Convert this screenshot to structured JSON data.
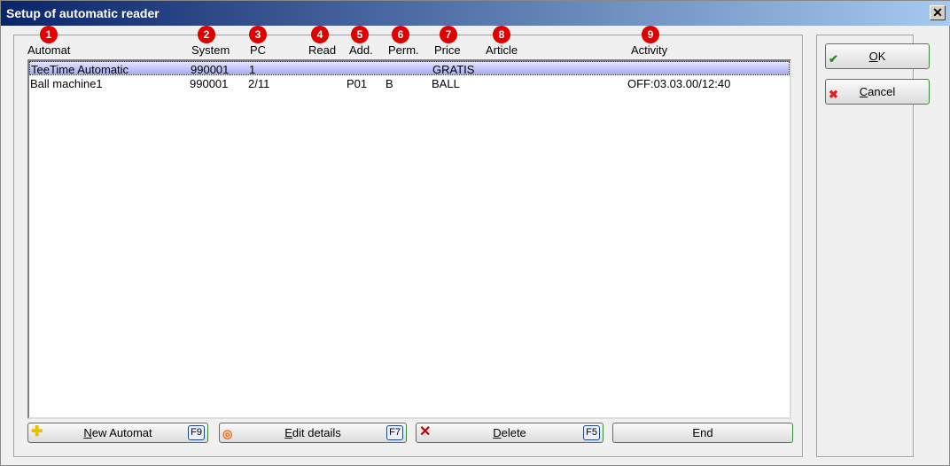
{
  "window": {
    "title": "Setup of automatic reader",
    "close": "✕"
  },
  "columns": [
    {
      "label": "Automat",
      "badge": "1"
    },
    {
      "label": "System",
      "badge": "2"
    },
    {
      "label": "PC",
      "badge": "3"
    },
    {
      "label": "Read",
      "badge": "4"
    },
    {
      "label": "Add.",
      "badge": "5"
    },
    {
      "label": "Perm.",
      "badge": "6"
    },
    {
      "label": "Price",
      "badge": "7"
    },
    {
      "label": "Article",
      "badge": "8"
    },
    {
      "label": "Activity",
      "badge": "9"
    }
  ],
  "rows": [
    {
      "automat": "TeeTime Automatic",
      "system": "990001",
      "pc": "1",
      "read": "",
      "add": "",
      "perm": "",
      "price": "GRATIS",
      "article": "",
      "activity": ""
    },
    {
      "automat": "Ball machine1",
      "system": "990001",
      "pc": "2/11",
      "read": "",
      "add": "P01",
      "perm": "B",
      "price": "BALL",
      "article": "",
      "activity": "OFF:03.03.00/12:40"
    }
  ],
  "buttons": {
    "new": {
      "key": "N",
      "rest": "ew Automat",
      "fkey": "F9"
    },
    "edit": {
      "key": "E",
      "rest": "dit details",
      "fkey": "F7"
    },
    "delete": {
      "key": "D",
      "rest": "elete",
      "fkey": "F5"
    },
    "end": "End",
    "ok": {
      "key": "O",
      "rest": "K"
    },
    "cancel": {
      "key": "C",
      "rest": "ancel"
    }
  }
}
